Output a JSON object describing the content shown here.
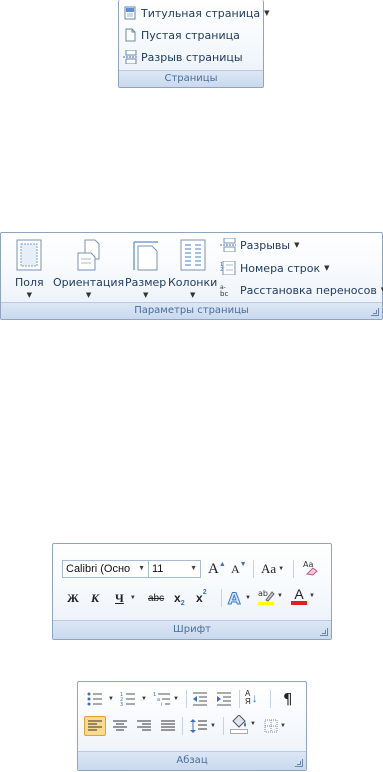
{
  "pages_group": {
    "title_page_label": "Титульная страница",
    "blank_page_label": "Пустая страница",
    "page_break_label": "Разрыв страницы",
    "group_label": "Страницы"
  },
  "page_setup_group": {
    "margins_label": "Поля",
    "orientation_label": "Ориентация",
    "size_label": "Размер",
    "columns_label": "Колонки",
    "breaks_label": "Разрывы",
    "line_numbers_label": "Номера строк",
    "hyphenation_label": "Расстановка переносов",
    "group_label": "Параметры страницы"
  },
  "font_group": {
    "font_name_value": "Calibri (Осно",
    "font_size_value": "11",
    "grow_font_glyph": "A",
    "shrink_font_glyph": "A",
    "change_case_glyph": "Aa",
    "bold_glyph": "Ж",
    "italic_glyph": "К",
    "underline_glyph": "Ч",
    "strikethrough_glyph": "abc",
    "subscript_glyph": "x",
    "subscript_sub": "2",
    "superscript_glyph": "x",
    "superscript_sup": "2",
    "highlight_glyph": "ab",
    "font_color_glyph": "A",
    "group_label": "Шрифт"
  },
  "paragraph_group": {
    "sort_glyph": "A",
    "sort_glyph_2": "Я",
    "pilcrow_glyph": "¶",
    "group_label": "Абзац"
  },
  "colors": {
    "ribbon_text": "#1e395b",
    "group_label_text": "#4a6d99",
    "font_color_bar": "#e0201b",
    "highlight_bar": "#ffff00",
    "active_button": "#fbd98d"
  }
}
